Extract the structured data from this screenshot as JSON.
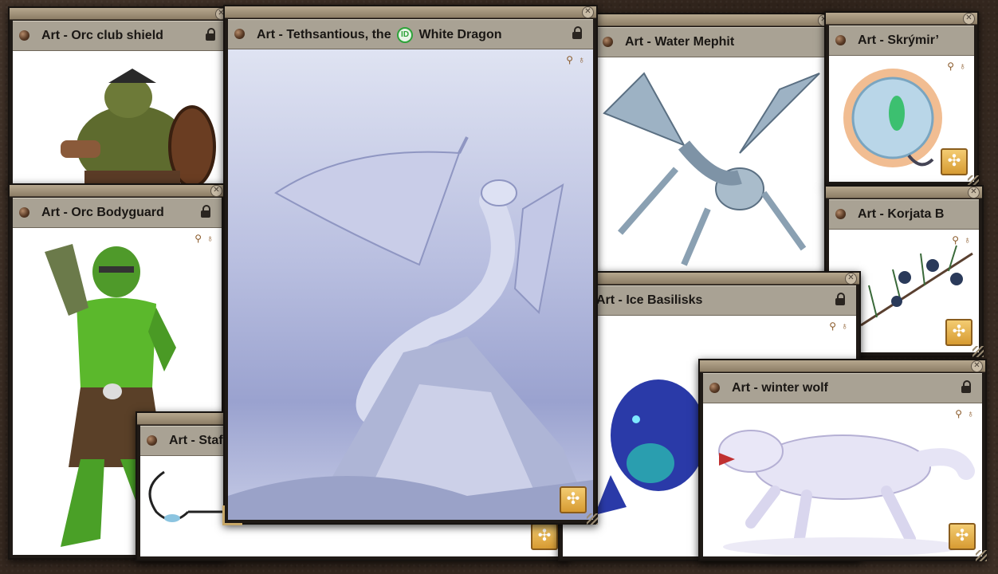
{
  "windows": {
    "orc_shield": {
      "title": "Art - Orc club shield"
    },
    "orc_bodyguard": {
      "title": "Art - Orc Bodyguard"
    },
    "staff": {
      "title": "Art - Staf"
    },
    "dragon": {
      "title_prefix": "Art - Tethsantious, the",
      "id_badge": "ID",
      "title_suffix": "White Dragon"
    },
    "mephit": {
      "title": "Art - Water Mephit"
    },
    "skrymir": {
      "title": "Art - Skrýmir’"
    },
    "korjata": {
      "title": "Art - Korjata B"
    },
    "basilisks": {
      "title": "Art - Ice Basilisks"
    },
    "winter_wolf": {
      "title": "Art - winter wolf"
    }
  },
  "icons": {
    "close": "✕",
    "share": "✣",
    "pin_a": "⚲",
    "pin_b": "♁"
  }
}
